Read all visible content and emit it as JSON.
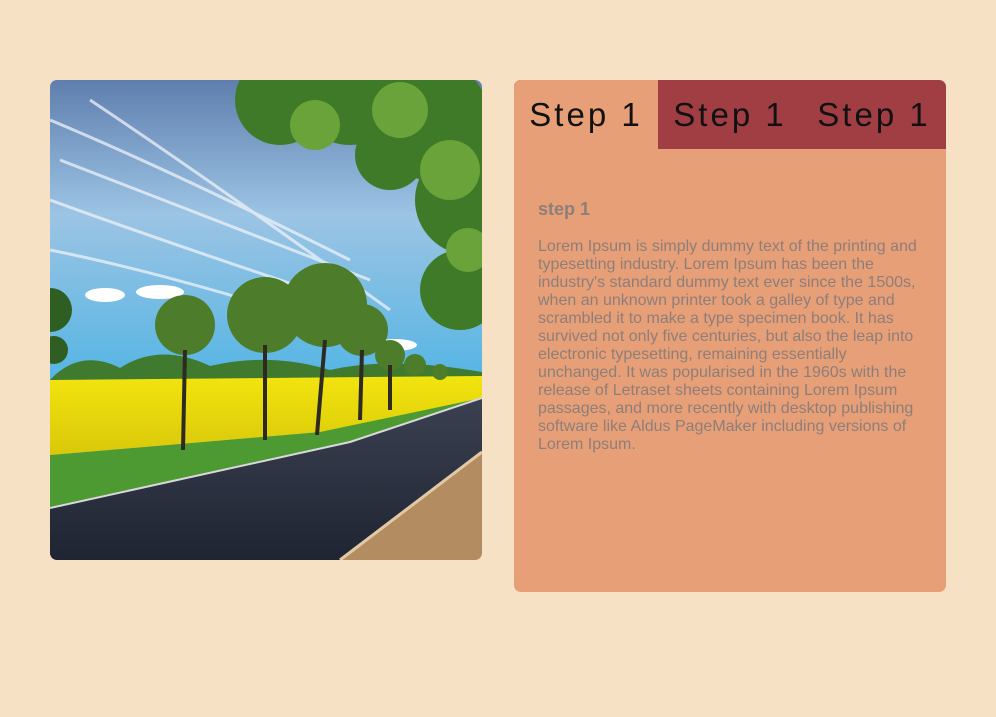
{
  "colors": {
    "page_background": "#f6e1c4",
    "panel_background": "#e79f77",
    "tabbar_background": "#a13e44",
    "tab_text": "#111111",
    "body_text": "#8e7e7a"
  },
  "photo": {
    "icon": "landscape-photo"
  },
  "tabs": [
    {
      "label": "Step 1",
      "active": true
    },
    {
      "label": "Step 1",
      "active": false
    },
    {
      "label": "Step 1",
      "active": false
    }
  ],
  "content": {
    "heading": "step 1",
    "body": "Lorem Ipsum is simply dummy text of the printing and typesetting industry. Lorem Ipsum has been the industry's standard dummy text ever since the 1500s, when an unknown printer took a galley of type and scrambled it to make a type specimen book. It has survived not only five centuries, but also the leap into electronic typesetting, remaining essentially unchanged. It was popularised in the 1960s with the release of Letraset sheets containing Lorem Ipsum passages, and more recently with desktop publishing software like Aldus PageMaker including versions of Lorem Ipsum."
  }
}
